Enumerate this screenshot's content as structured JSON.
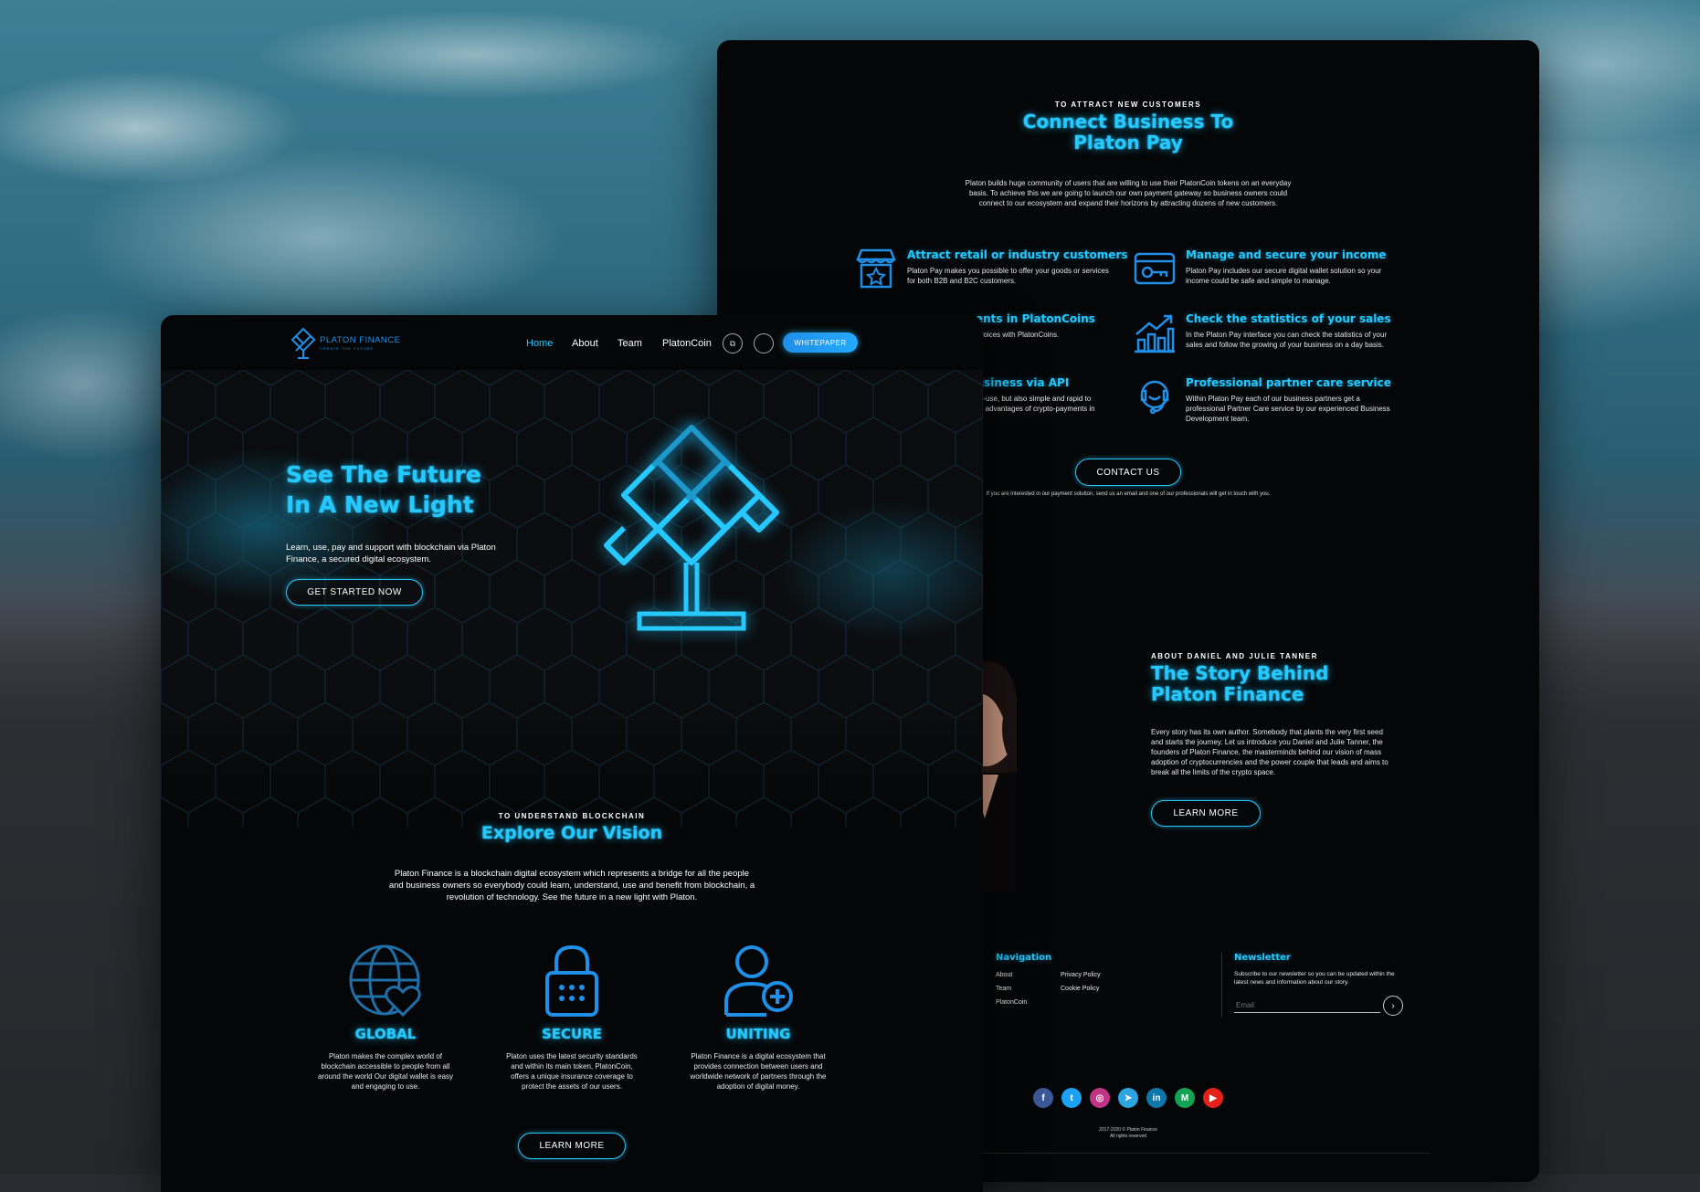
{
  "colors": {
    "accent": "#25c9ff",
    "bg": "#050607",
    "button_fill": "#1f8fe8"
  },
  "back": {
    "pay": {
      "eyebrow": "TO ATTRACT NEW CUSTOMERS",
      "title_line1": "Connect Business To",
      "title_line2": "Platon Pay",
      "desc_line1": "Platon builds huge community of users that are willing to use their PlatonCoin tokens on an everyday",
      "desc_line2": "basis. To achieve this we are going to launch our own payment gateway so business owners could",
      "desc_line3": "connect to our ecosystem and expand their horizons by attracting dozens of new customers.",
      "features": [
        {
          "icon": "store-icon",
          "title": "Attract retail or industry customers",
          "line1": "Platon Pay makes you possible to offer your goods or services",
          "line2": "for both B2B and B2C customers.",
          "line3": ""
        },
        {
          "icon": "card-key-icon",
          "title": "Manage and secure your income",
          "line1": "Platon Pay includes our secure digital wallet solution so your",
          "line2": "income could be safe and simple to manage.",
          "line3": ""
        },
        {
          "icon": "coin-icon",
          "title": "ents in PlatonCoins",
          "line1": "r goods or invoices with PlatonCoins.",
          "line2": "",
          "line3": ""
        },
        {
          "icon": "chart-icon",
          "title": "Check the statistics of your sales",
          "line1": "In the Platon Pay interface you can check the statistics of your",
          "line2": "sales and follow the growing of your business on a day basis.",
          "line3": ""
        },
        {
          "icon": "api-icon",
          "title": "business via API",
          "line1": "sy-to-use, but also simple and rapid to",
          "line2": "y the advantages of crypto-payments in",
          "line3": ""
        },
        {
          "icon": "headset-icon",
          "title": "Professional partner care service",
          "line1": "Within Platon Pay each of our business partners get a",
          "line2": "professional Partner Care service by our experienced Business",
          "line3": "Development team."
        }
      ],
      "contact_label": "CONTACT US",
      "contact_note": "If you are interested in our payment solution, send us an email and one of our professionals will get in touch with you."
    },
    "story": {
      "eyebrow": "ABOUT DANIEL AND JULIE TANNER",
      "title_line1": "The Story Behind",
      "title_line2": "Platon Finance",
      "p1": "Every story has its own author. Somebody that plants the very first seed",
      "p2": "and starts the journey. Let us introduce you Daniel and Julie Tanner, the",
      "p3": "founders of Platon Finance, the masterminds behind our vision of mass",
      "p4": "adoption of cryptocurrencies and the power couple that leads and aims to",
      "p5": "break all the limits of the crypto space.",
      "button": "LEARN MORE"
    },
    "footer": {
      "nav_title": "Navigation",
      "nav_col1": [
        "About",
        "Team",
        "PlatonCoin"
      ],
      "nav_col2": [
        "Privacy Policy",
        "Cookie Policy"
      ],
      "newsletter_title": "Newsletter",
      "newsletter_line1": "Subscribe to our newsletter so you can be updated within the",
      "newsletter_line2": "latest news and information about our story.",
      "email_placeholder": "Email",
      "socials": [
        {
          "name": "facebook",
          "glyph": "f",
          "color": "#3b5998"
        },
        {
          "name": "twitter",
          "glyph": "t",
          "color": "#1da1f2"
        },
        {
          "name": "instagram",
          "glyph": "◎",
          "color": "#c13584"
        },
        {
          "name": "telegram",
          "glyph": "➤",
          "color": "#2ca5e0"
        },
        {
          "name": "linkedin",
          "glyph": "in",
          "color": "#0e76a8"
        },
        {
          "name": "medium",
          "glyph": "M",
          "color": "#12a454"
        },
        {
          "name": "youtube",
          "glyph": "▶",
          "color": "#e62117"
        }
      ],
      "copyright_line1": "2017-2020 © Platon Finance",
      "copyright_line2": "All rights reserved"
    }
  },
  "front": {
    "brand": "PLATON FINANCE",
    "tagline": "CREATE THE FUTURE",
    "nav": [
      "Home",
      "About",
      "Team",
      "PlatonCoin"
    ],
    "whitepaper": "WHITEPAPER",
    "hero": {
      "title_line1": "See The Future",
      "title_line2": "In A New Light",
      "desc_line1": "Learn, use, pay and support with blockchain via Platon",
      "desc_line2": "Finance, a secured digital ecosystem.",
      "cta": "GET STARTED NOW"
    },
    "vision": {
      "eyebrow": "TO UNDERSTAND BLOCKCHAIN",
      "title": "Explore Our Vision",
      "line1": "Platon Finance is a blockchain digital ecosystem which represents a bridge for all the people",
      "line2": "and business owners so everybody could learn, understand, use and benefit from blockchain, a",
      "line3": "revolution of technology. See the future in a new light with Platon.",
      "items": [
        {
          "title": "GLOBAL",
          "l1": "Platon makes the complex world of",
          "l2": "blockchain accessible to people from all",
          "l3": "around the world Our digital wallet is easy",
          "l4": "and engaging to use."
        },
        {
          "title": "SECURE",
          "l1": "Platon uses the latest security standards",
          "l2": "and within its main token, PlatonCoin,",
          "l3": "offers a unique insurance coverage to",
          "l4": "protect the assets of our users."
        },
        {
          "title": "UNITING",
          "l1": "Platon Finance is a digital ecosystem that",
          "l2": "provides connection between users and",
          "l3": "worldwide network of partners through the",
          "l4": "adoption of digital money."
        }
      ],
      "button": "LEARN MORE"
    }
  }
}
